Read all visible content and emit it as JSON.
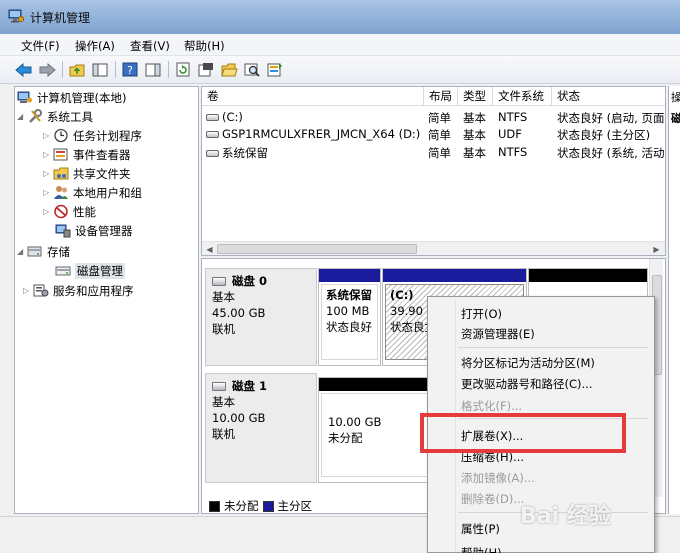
{
  "window": {
    "title": "计算机管理"
  },
  "menubar": {
    "items": [
      "文件(F)",
      "操作(A)",
      "查看(V)",
      "帮助(H)"
    ]
  },
  "toolbar": {
    "buttons": [
      "back-icon",
      "forward-icon",
      "up-folder-icon",
      "show-tree-icon",
      "help-icon",
      "panel-icon",
      "refresh-icon",
      "properties-icon",
      "open-folder-icon",
      "search-icon",
      "export-icon"
    ]
  },
  "tree": {
    "root": "计算机管理(本地)",
    "system_tools": "系统工具",
    "children": [
      "任务计划程序",
      "事件查看器",
      "共享文件夹",
      "本地用户和组",
      "性能",
      "设备管理器"
    ],
    "storage": "存储",
    "disk_mgmt": "磁盘管理",
    "services": "服务和应用程序"
  },
  "list": {
    "columns": [
      "卷",
      "布局",
      "类型",
      "文件系统",
      "状态"
    ],
    "right_col_head": "操",
    "right_col_cell": "磁",
    "rows": [
      {
        "volume": "(C:)",
        "layout": "简单",
        "type": "基本",
        "fs": "NTFS",
        "status": "状态良好 (启动, 页面"
      },
      {
        "volume": "GSP1RMCULXFRER_JMCN_X64 (D:)",
        "layout": "简单",
        "type": "基本",
        "fs": "UDF",
        "status": "状态良好 (主分区)"
      },
      {
        "volume": "系统保留",
        "layout": "简单",
        "type": "基本",
        "fs": "NTFS",
        "status": "状态良好 (系统, 活动"
      }
    ]
  },
  "disks": {
    "disk0": {
      "name": "磁盘 0",
      "type": "基本",
      "size": "45.00 GB",
      "state": "联机"
    },
    "disk0_parts": [
      {
        "name": "系统保留",
        "size": "100 MB",
        "status": "状态良好"
      },
      {
        "name": "(C:)",
        "size": "39.90 C",
        "status": "状态良女"
      }
    ],
    "disk1": {
      "name": "磁盘 1",
      "type": "基本",
      "size": "10.00 GB",
      "state": "联机"
    },
    "disk1_parts": [
      {
        "size": "10.00 GB",
        "status": "未分配"
      }
    ],
    "legend": [
      "未分配",
      "主分区"
    ],
    "colors": {
      "unallocated": "#000000",
      "primary": "#1a1a9c"
    }
  },
  "context_menu": {
    "items": [
      {
        "label": "打开(O)",
        "disabled": false
      },
      {
        "label": "资源管理器(E)",
        "disabled": false
      },
      {
        "label": "将分区标记为活动分区(M)",
        "disabled": false
      },
      {
        "label": "更改驱动器号和路径(C)...",
        "disabled": false
      },
      {
        "label": "格式化(F)...",
        "disabled": true
      },
      {
        "label": "扩展卷(X)...",
        "disabled": false
      },
      {
        "label": "压缩卷(H)...",
        "disabled": false
      },
      {
        "label": "添加镜像(A)...",
        "disabled": true
      },
      {
        "label": "删除卷(D)...",
        "disabled": true
      },
      {
        "label": "属性(P)",
        "disabled": false
      },
      {
        "label": "帮助(H)",
        "disabled": false
      }
    ],
    "highlight_color": "#e63b3b"
  },
  "watermark": "Bai 经验"
}
